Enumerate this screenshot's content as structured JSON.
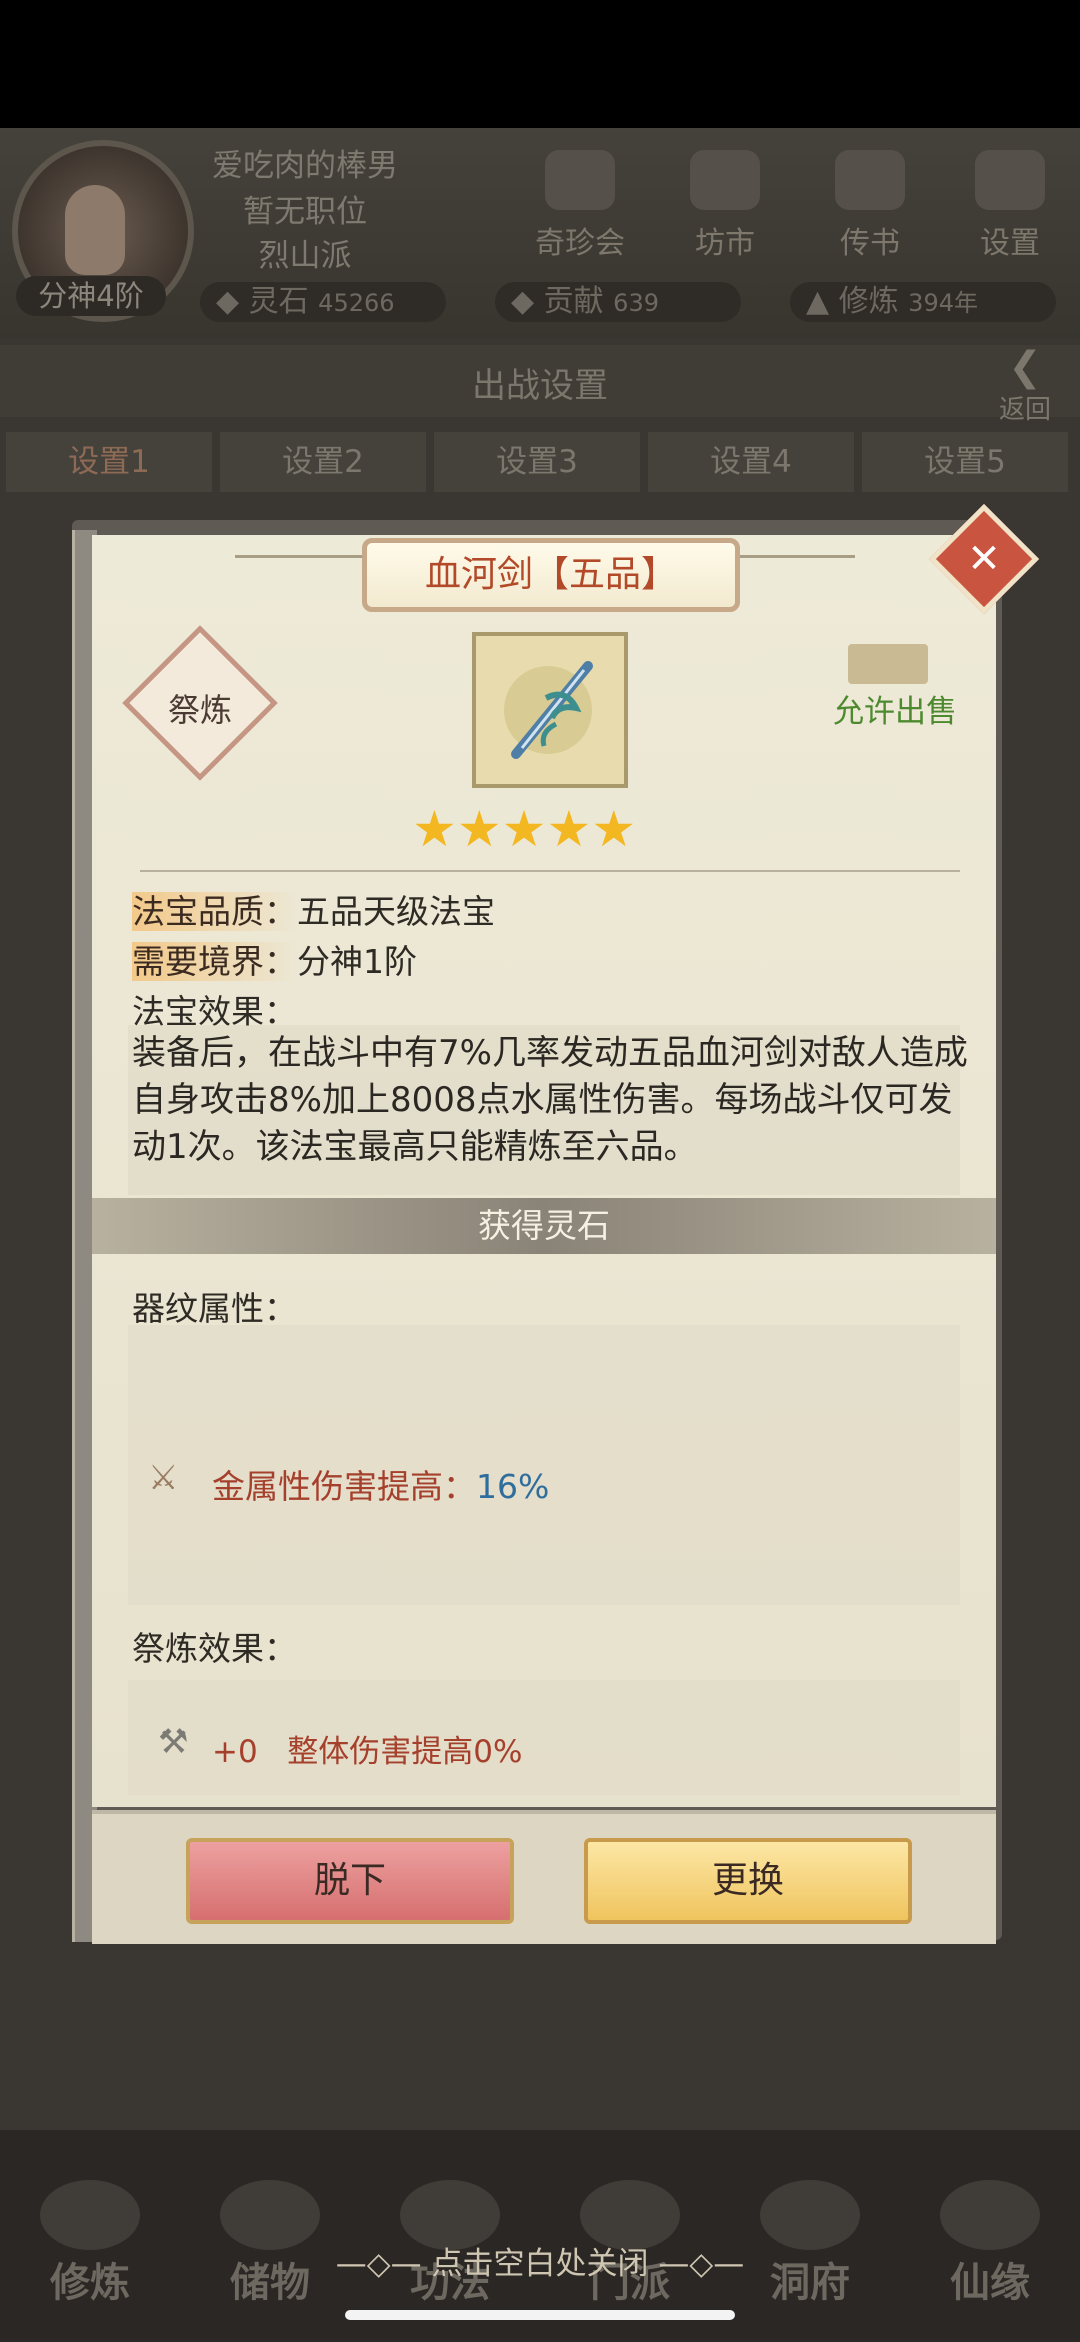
{
  "player": {
    "name": "爱吃肉的棒男",
    "position": "暂无职位",
    "sect": "烈山派",
    "realm": "分神4阶"
  },
  "resources": [
    {
      "label": "灵石",
      "value": "45266"
    },
    {
      "label": "贡献",
      "value": "639"
    },
    {
      "label": "修炼",
      "value": "394年"
    }
  ],
  "top_buttons": [
    "奇珍会",
    "坊市",
    "传书",
    "设置"
  ],
  "screen_title": "出战设置",
  "back_label": "返回",
  "tabs": [
    "设置1",
    "设置2",
    "设置3",
    "设置4",
    "设置5"
  ],
  "dialog": {
    "title": "血河剑【五品】",
    "refine_label": "祭炼",
    "sell_label": "允许出售",
    "stars": 5,
    "quality_label": "法宝品质：",
    "quality_value": "五品天级法宝",
    "realm_label": "需要境界：",
    "realm_value": "分神1阶",
    "effect_label": "法宝效果：",
    "effect_text": "装备后，在战斗中有7%几率发动五品血河剑对敌人造成自身攻击8%加上8008点水属性伤害。每场战斗仅可发动1次。该法宝最高只能精炼至六品。",
    "stone_label": "获得灵石",
    "qiwen_label": "器纹属性：",
    "qiwen_attr_name": "金属性伤害提高：",
    "qiwen_attr_value": "16%",
    "refine_effect_label": "祭炼效果：",
    "refine_level": "+0",
    "refine_effect_text": "整体伤害提高0%",
    "unequip_label": "脱下",
    "replace_label": "更换"
  },
  "bottom_nav": [
    "修炼",
    "储物",
    "功法",
    "门派",
    "洞府",
    "仙缘"
  ],
  "close_hint": "点击空白处关闭",
  "colors": {
    "title_red": "#b24a2a",
    "sell_green": "#4d8a2f",
    "star_gold": "#f3b722",
    "value_blue": "#2f6d9c",
    "attr_red": "#a5402c",
    "unequip_pink": "#e38a8a",
    "replace_gold": "#f5d27c"
  }
}
